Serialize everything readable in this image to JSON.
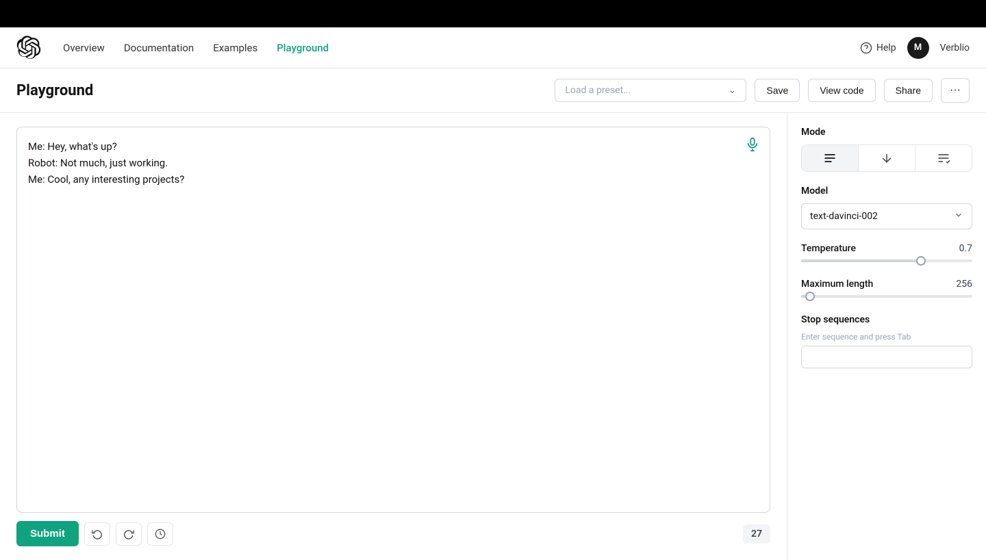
{
  "topBar": {},
  "nav": {
    "links": [
      {
        "label": "Overview",
        "active": false
      },
      {
        "label": "Documentation",
        "active": false
      },
      {
        "label": "Examples",
        "active": false
      },
      {
        "label": "Playground",
        "active": true
      }
    ],
    "help": "Help",
    "user": {
      "initial": "M",
      "name": "Verblio"
    }
  },
  "toolbar": {
    "title": "Playground",
    "presetPlaceholder": "Load a preset...",
    "saveLabel": "Save",
    "viewCodeLabel": "View code",
    "shareLabel": "Share",
    "moreLabel": "···"
  },
  "editor": {
    "content": "Me: Hey, what's up?\nRobot: Not much, just working.\nMe: Cool, any interesting projects?",
    "tokenCount": "27"
  },
  "buttons": {
    "submit": "Submit",
    "undo": "↺",
    "redo": "↻",
    "history": "⏱"
  },
  "rightPanel": {
    "modeLabel": "Mode",
    "modelLabel": "Model",
    "modelValue": "text-davinci-002",
    "temperatureLabel": "Temperature",
    "temperatureValue": "0.7",
    "temperaturePercent": 70,
    "maxLengthLabel": "Maximum length",
    "maxLengthValue": "256",
    "maxLengthPercent": 5,
    "stopSeqLabel": "Stop sequences",
    "stopSeqHint": "Enter sequence and press Tab",
    "stopSeqPlaceholder": ""
  }
}
